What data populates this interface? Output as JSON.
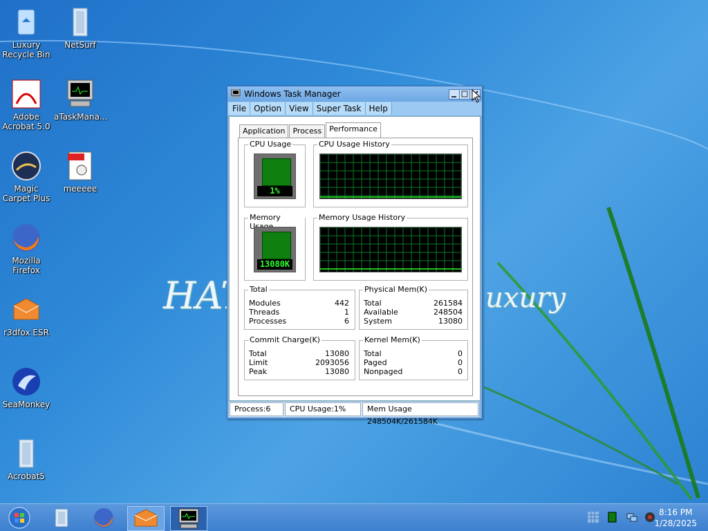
{
  "wallpaper": {
    "brand_left": "HAT",
    "brand_right": "uxury"
  },
  "desktop_icons": [
    {
      "label": "Luxury Recycle Bin"
    },
    {
      "label": "NetSurf"
    },
    {
      "label": "Adobe Acrobat 5.0"
    },
    {
      "label": "aTaskMana..."
    },
    {
      "label": "Magic Carpet Plus"
    },
    {
      "label": "meeeee"
    },
    {
      "label": "Mozilla Firefox"
    },
    {
      "label": "r3dfox ESR"
    },
    {
      "label": "SeaMonkey"
    },
    {
      "label": "Acrobat5"
    }
  ],
  "window": {
    "title": "Windows Task Manager",
    "menu": [
      "File",
      "Option",
      "View",
      "Super Task",
      "Help"
    ],
    "tabs": [
      "Application",
      "Process",
      "Performance"
    ],
    "active_tab": "Performance",
    "cpu_usage": {
      "label": "CPU Usage",
      "value": "1%"
    },
    "cpu_history": {
      "label": "CPU Usage History"
    },
    "memory_usage": {
      "label": "Memory Usage",
      "value": "13080K"
    },
    "memory_history": {
      "label": "Memory Usage History"
    },
    "totals": {
      "label": "Total",
      "rows": [
        {
          "name": "Modules",
          "value": "442"
        },
        {
          "name": "Threads",
          "value": "1"
        },
        {
          "name": "Processes",
          "value": "6"
        }
      ]
    },
    "physical_mem": {
      "label": "Physical Mem(K)",
      "rows": [
        {
          "name": "Total",
          "value": "261584"
        },
        {
          "name": "Available",
          "value": "248504"
        },
        {
          "name": "System",
          "value": "13080"
        }
      ]
    },
    "commit_charge": {
      "label": "Commit Charge(K)",
      "rows": [
        {
          "name": "Total",
          "value": "13080"
        },
        {
          "name": "Limit",
          "value": "2093056"
        },
        {
          "name": "Peak",
          "value": "13080"
        }
      ]
    },
    "kernel_mem": {
      "label": "Kernel Mem(K)",
      "rows": [
        {
          "name": "Total",
          "value": "0"
        },
        {
          "name": "Paged",
          "value": "0"
        },
        {
          "name": "Nonpaged",
          "value": "0"
        }
      ]
    },
    "status": {
      "process": "Process:6",
      "cpu": "CPU Usage:1%",
      "mem": "Mem Usage 248504K/261584K"
    }
  },
  "taskbar": {
    "clock_time": "8:16 PM",
    "clock_date": "1/28/2025"
  },
  "colors": {
    "accent": "#3d7fcf",
    "graph_grid": "#0a7a2a",
    "meter_text": "#2fff2f"
  }
}
